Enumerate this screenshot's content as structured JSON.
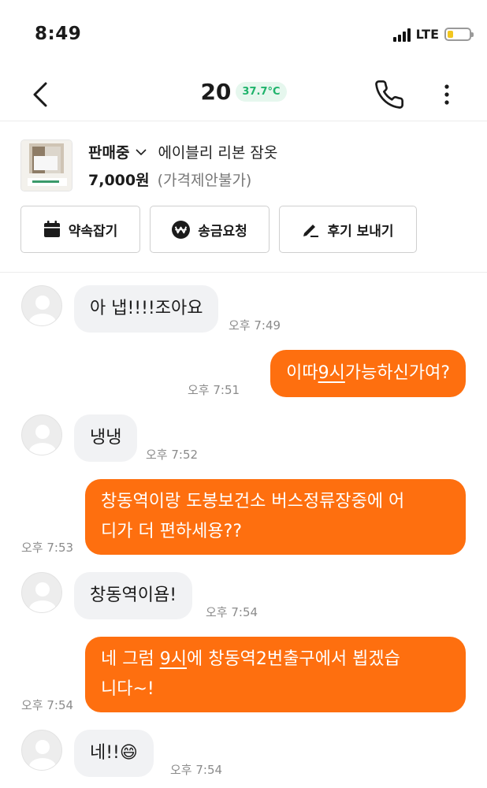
{
  "status_bar": {
    "time": "8:49",
    "network": "LTE",
    "battery_level": 0.25
  },
  "header": {
    "title": "20",
    "temperature": "37.7°C"
  },
  "product": {
    "status": "판매중",
    "title": "에이블리 리본 잠옷",
    "price": "7,000원",
    "negotiation": "(가격제안불가)"
  },
  "actions": [
    {
      "label": "약속잡기",
      "icon": "calendar-icon"
    },
    {
      "label": "송금요청",
      "icon": "won-icon"
    },
    {
      "label": "후기 보내기",
      "icon": "pencil-icon"
    }
  ],
  "messages": [
    {
      "sender": "other",
      "text": "아 냅!!!!조아요",
      "time": "오후 7:49"
    },
    {
      "sender": "me",
      "pre": "이따",
      "link": "9시",
      "post": "가능하신가여?",
      "time": "오후 7:51"
    },
    {
      "sender": "other",
      "text": "냉냉",
      "time": "오후 7:52"
    },
    {
      "sender": "me",
      "line1": "창동역이랑 도봉보건소 버스정류장중에 어",
      "line2": "디가 더 편하세용??",
      "time": "오후 7:53"
    },
    {
      "sender": "other",
      "text": "창동역이욤!",
      "time": "오후 7:54"
    },
    {
      "sender": "me",
      "pre": "네 그럼 ",
      "link": "9시",
      "post": "에 창동역2번출구에서 뵙겠습",
      "line2": "니다~!",
      "time": "오후 7:54"
    },
    {
      "sender": "other",
      "text": "네!!",
      "emoji": "😄",
      "time": "오후 7:54"
    }
  ],
  "colors": {
    "accent": "#fe6f0f",
    "incoming_bubble": "#f1f2f4",
    "temperature": "#1eb36b"
  }
}
